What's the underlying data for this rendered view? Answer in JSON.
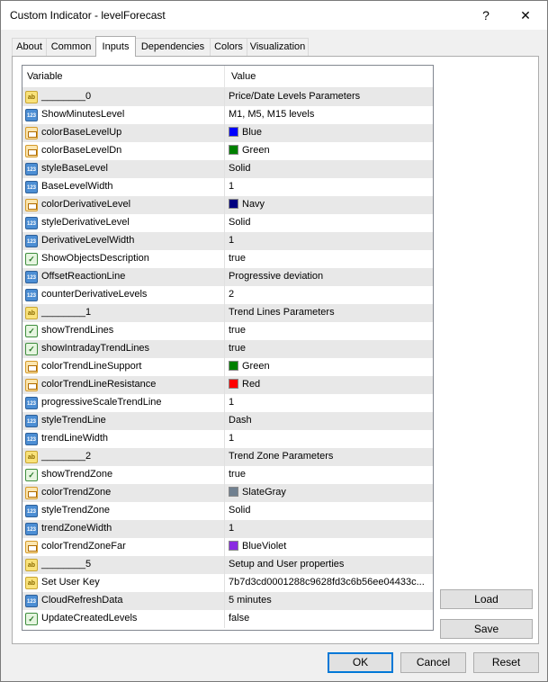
{
  "window": {
    "title": "Custom Indicator - levelForecast",
    "help_label": "?",
    "close_label": "✕"
  },
  "tabs": [
    "About",
    "Common",
    "Inputs",
    "Dependencies",
    "Colors",
    "Visualization"
  ],
  "active_tab": "Inputs",
  "grid": {
    "columns": [
      "Variable",
      "Value"
    ],
    "rows": [
      {
        "type": "ab",
        "name": "________0",
        "value": "Price/Date Levels Parameters"
      },
      {
        "type": "num",
        "name": "ShowMinutesLevel",
        "value": "M1, M5, M15  levels"
      },
      {
        "type": "col",
        "name": "colorBaseLevelUp",
        "value": "Blue",
        "color": "#0000ff"
      },
      {
        "type": "col",
        "name": "colorBaseLevelDn",
        "value": "Green",
        "color": "#008000"
      },
      {
        "type": "num",
        "name": "styleBaseLevel",
        "value": "Solid"
      },
      {
        "type": "num",
        "name": "BaseLevelWidth",
        "value": "1"
      },
      {
        "type": "col",
        "name": "colorDerivativeLevel",
        "value": "Navy",
        "color": "#000080"
      },
      {
        "type": "num",
        "name": "styleDerivativeLevel",
        "value": "Solid"
      },
      {
        "type": "num",
        "name": "DerivativeLevelWidth",
        "value": "1"
      },
      {
        "type": "bool",
        "name": "ShowObjectsDescription",
        "value": "true"
      },
      {
        "type": "num",
        "name": "OffsetReactionLine",
        "value": "Progressive deviation"
      },
      {
        "type": "num",
        "name": "counterDerivativeLevels",
        "value": "2"
      },
      {
        "type": "ab",
        "name": "________1",
        "value": "Trend Lines Parameters"
      },
      {
        "type": "bool",
        "name": "showTrendLines",
        "value": "true"
      },
      {
        "type": "bool",
        "name": "showIntradayTrendLines",
        "value": "true"
      },
      {
        "type": "col",
        "name": "colorTrendLineSupport",
        "value": "Green",
        "color": "#008000"
      },
      {
        "type": "col",
        "name": "colorTrendLineResistance",
        "value": "Red",
        "color": "#ff0000"
      },
      {
        "type": "num",
        "name": "progressiveScaleTrendLine",
        "value": "1"
      },
      {
        "type": "num",
        "name": "styleTrendLine",
        "value": "Dash"
      },
      {
        "type": "num",
        "name": "trendLineWidth",
        "value": "1"
      },
      {
        "type": "ab",
        "name": "________2",
        "value": "Trend Zone Parameters"
      },
      {
        "type": "bool",
        "name": "showTrendZone",
        "value": "true"
      },
      {
        "type": "col",
        "name": "colorTrendZone",
        "value": "SlateGray",
        "color": "#708090"
      },
      {
        "type": "num",
        "name": "styleTrendZone",
        "value": "Solid"
      },
      {
        "type": "num",
        "name": "trendZoneWidth",
        "value": "1"
      },
      {
        "type": "col",
        "name": "colorTrendZoneFar",
        "value": "BlueViolet",
        "color": "#8a2be2"
      },
      {
        "type": "ab",
        "name": "________5",
        "value": "Setup and User properties"
      },
      {
        "type": "ab",
        "name": "Set User Key",
        "value": "7b7d3cd0001288c9628fd3c6b56ee04433c..."
      },
      {
        "type": "num",
        "name": "CloudRefreshData",
        "value": "5 minutes"
      },
      {
        "type": "bool",
        "name": "UpdateCreatedLevels",
        "value": "false"
      }
    ]
  },
  "side_buttons": {
    "load": "Load",
    "save": "Save"
  },
  "footer_buttons": {
    "ok": "OK",
    "cancel": "Cancel",
    "reset": "Reset"
  },
  "icon_names": {
    "ab": "string-type-icon",
    "num": "integer-type-icon",
    "bool": "boolean-type-icon",
    "col": "color-type-icon"
  },
  "icon_glyphs": {
    "ab": "ab",
    "num": "123",
    "bool": "✓",
    "col": ""
  }
}
